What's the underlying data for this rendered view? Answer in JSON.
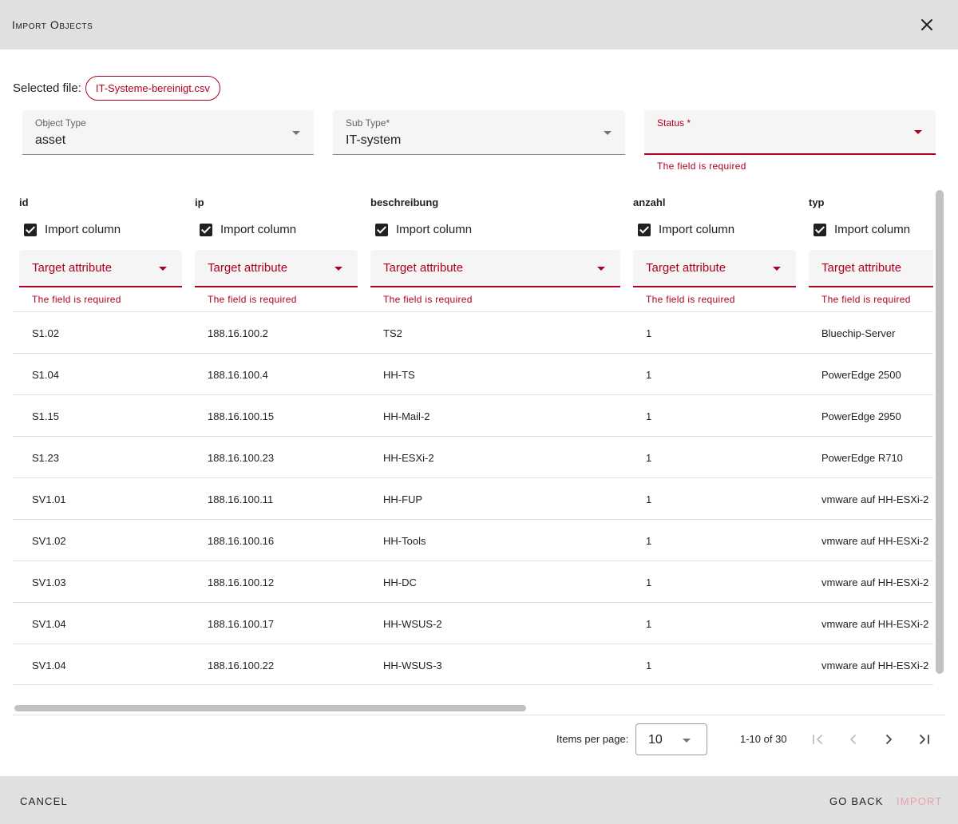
{
  "dialog": {
    "title": "Import Objects"
  },
  "file": {
    "label": "Selected file:",
    "name": "IT-Systeme-bereinigt.csv"
  },
  "filters": {
    "object_type": {
      "label": "Object Type",
      "value": "asset"
    },
    "sub_type": {
      "label": "Sub Type*",
      "value": "IT-system"
    },
    "status": {
      "label": "Status *",
      "value": "",
      "error": "The field is required"
    }
  },
  "table": {
    "import_label": "Import column",
    "target_label": "Target attribute",
    "error_label": "The field is required",
    "columns": [
      {
        "name": "id",
        "checked": true
      },
      {
        "name": "ip",
        "checked": true
      },
      {
        "name": "beschreibung",
        "checked": true
      },
      {
        "name": "anzahl",
        "checked": true
      },
      {
        "name": "typ",
        "checked": true
      }
    ],
    "rows": [
      [
        "S1.02",
        "188.16.100.2",
        "TS2",
        "1",
        "Bluechip-Server"
      ],
      [
        "S1.04",
        "188.16.100.4",
        "HH-TS",
        "1",
        "PowerEdge 2500"
      ],
      [
        "S1.15",
        "188.16.100.15",
        "HH-Mail-2",
        "1",
        "PowerEdge 2950"
      ],
      [
        "S1.23",
        "188.16.100.23",
        "HH-ESXi-2",
        "1",
        "PowerEdge R710"
      ],
      [
        "SV1.01",
        "188.16.100.11",
        "HH-FUP",
        "1",
        "vmware auf HH-ESXi-2"
      ],
      [
        "SV1.02",
        "188.16.100.16",
        "HH-Tools",
        "1",
        "vmware auf HH-ESXi-2"
      ],
      [
        "SV1.03",
        "188.16.100.12",
        "HH-DC",
        "1",
        "vmware auf HH-ESXi-2"
      ],
      [
        "SV1.04",
        "188.16.100.17",
        "HH-WSUS-2",
        "1",
        "vmware auf HH-ESXi-2"
      ],
      [
        "SV1.04",
        "188.16.100.22",
        "HH-WSUS-3",
        "1",
        "vmware auf HH-ESXi-2"
      ]
    ]
  },
  "pagination": {
    "items_per_page_label": "Items per page:",
    "page_size": "10",
    "range": "1-10 of 30"
  },
  "footer": {
    "cancel": "CANCEL",
    "go_back": "GO BACK",
    "import": "IMPORT"
  },
  "colors": {
    "accent": "#b00020",
    "header_bg": "#e0e0e0",
    "field_bg": "#f5f5f5",
    "disabled": "#e6a3ad"
  }
}
